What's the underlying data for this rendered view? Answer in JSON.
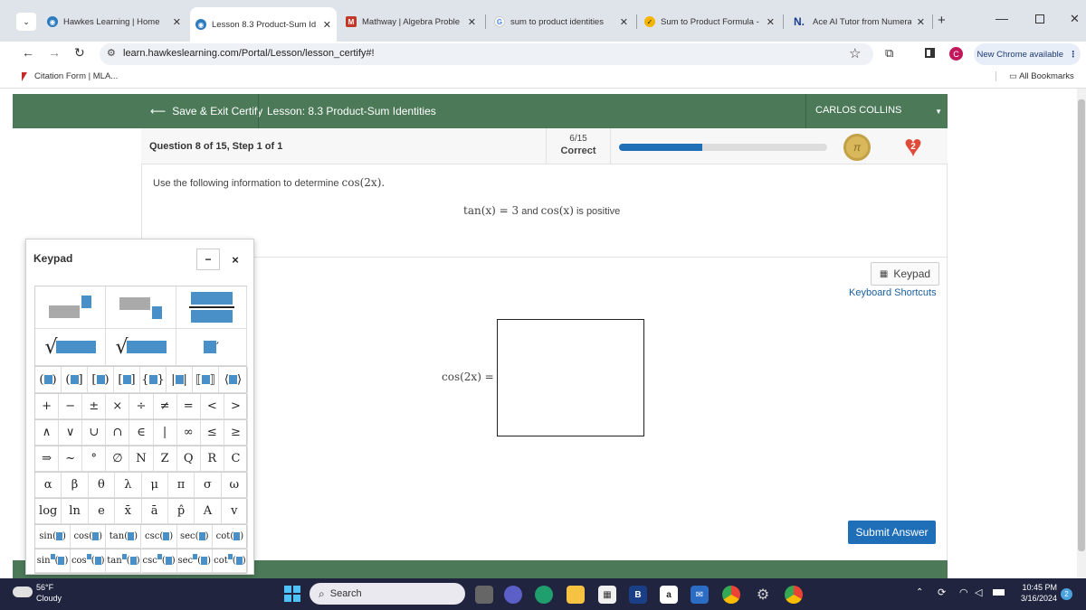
{
  "browser": {
    "tabs": [
      {
        "title": "Hawkes Learning | Home",
        "favicon_color": "#2c7bbf",
        "favicon_glyph": "◉"
      },
      {
        "title": "Lesson 8.3 Product-Sum Id",
        "favicon_color": "#2c7bbf",
        "favicon_glyph": "◉"
      },
      {
        "title": "Mathway | Algebra Proble",
        "favicon_color": "#c0392b",
        "favicon_glyph": "M"
      },
      {
        "title": "sum to product identities",
        "favicon_color": "#4285f4",
        "favicon_glyph": "G"
      },
      {
        "title": "Sum to Product Formula -",
        "favicon_color": "#f5b400",
        "favicon_glyph": "✓"
      },
      {
        "title": "Ace AI Tutor from Numera",
        "favicon_color": "#1a3d8f",
        "favicon_glyph": "N."
      }
    ],
    "url": "learn.hawkeslearning.com/Portal/Lesson/lesson_certify#!",
    "profile_initial": "C",
    "chrome_update": "New Chrome available",
    "bookmark": "Citation Form | MLA...",
    "all_bookmarks": "All Bookmarks"
  },
  "app": {
    "save_exit": "Save & Exit Certify",
    "lesson": "Lesson: 8.3 Product-Sum Identities",
    "user": "CARLOS COLLINS",
    "question_label": "Question 8 of 15, Step 1 of 1",
    "score": "6/15",
    "score_label": "Correct",
    "progress_fraction": 0.4,
    "lives": "2",
    "instruction": "Use the following information to determine",
    "instruction_expr": "cos(2x).",
    "given_tan": "tan(x) = 3",
    "given_and": "and",
    "given_cos": "cos(x)",
    "given_positive": "is positive",
    "keypad_button": "Keypad",
    "shortcuts": "Keyboard Shortcuts",
    "answer_label": "cos(2x) =",
    "answer_value": "",
    "submit": "Submit Answer"
  },
  "keypad": {
    "title": "Keypad",
    "minimize": "−",
    "close": "×",
    "ops_row": [
      "+",
      "−",
      "±",
      "×",
      "÷",
      "≠",
      "=",
      "<",
      ">"
    ],
    "set_row": [
      "∧",
      "∨",
      "∪",
      "∩",
      "∈",
      "|",
      "∞",
      "≤",
      "≥"
    ],
    "num_row": [
      "⇒",
      "~",
      "°",
      "∅",
      "N",
      "Z",
      "Q",
      "R",
      "C"
    ],
    "greek_row": [
      "α",
      "β",
      "θ",
      "λ",
      "μ",
      "π",
      "σ",
      "ω"
    ],
    "misc_row": [
      "log",
      "ln",
      "e",
      "x̄",
      "ā",
      "p̂",
      "A",
      "v"
    ],
    "trig_row": [
      "sin",
      "cos",
      "tan",
      "csc",
      "sec",
      "cot"
    ]
  },
  "taskbar": {
    "temp": "56°F",
    "weather": "Cloudy",
    "search": "Search",
    "time": "10:45 PM",
    "date": "3/16/2024",
    "notif_count": "2"
  }
}
